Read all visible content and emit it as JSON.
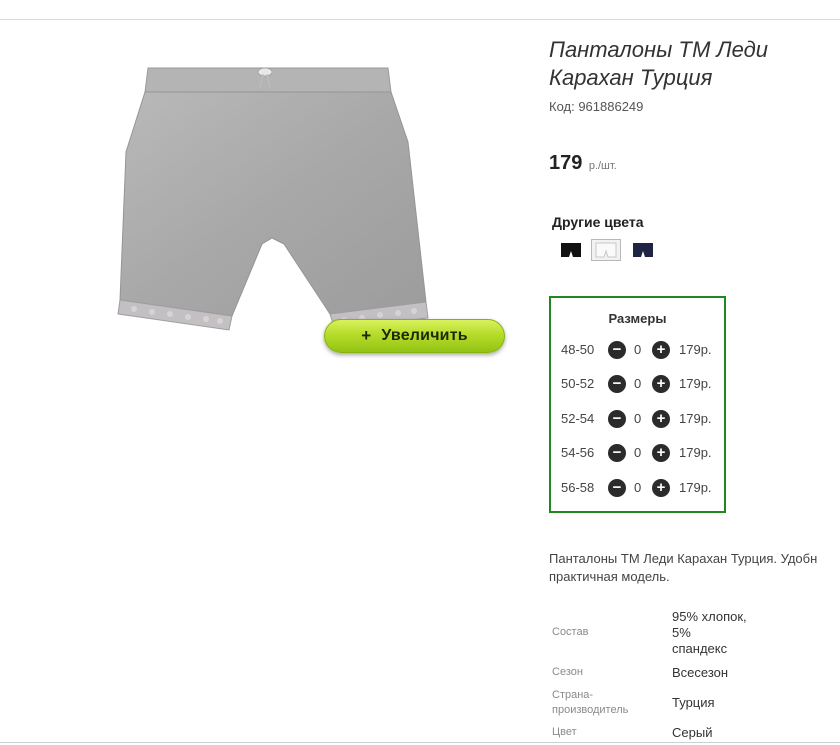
{
  "product": {
    "title": "Панталоны ТМ Леди Карахан Турция",
    "code": "Код: 961886249",
    "price": "179",
    "price_unit": "р./шт.",
    "zoom_label": "Увеличить"
  },
  "colors": {
    "heading": "Другие цвета",
    "swatches": [
      {
        "name": "black",
        "color": "#111111"
      },
      {
        "name": "white",
        "color": "#fafafa"
      },
      {
        "name": "navy",
        "color": "#1f2444"
      }
    ]
  },
  "sizes": {
    "heading": "Размеры",
    "rows": [
      {
        "label": "48-50",
        "qty": "0",
        "price": "179р."
      },
      {
        "label": "50-52",
        "qty": "0",
        "price": "179р."
      },
      {
        "label": "52-54",
        "qty": "0",
        "price": "179р."
      },
      {
        "label": "54-56",
        "qty": "0",
        "price": "179р."
      },
      {
        "label": "56-58",
        "qty": "0",
        "price": "179р."
      }
    ],
    "minus_symbol": "−",
    "plus_symbol": "+"
  },
  "description": {
    "line1": "Панталоны ТМ Леди Карахан Турция. Удобн",
    "line2": "практичная модель."
  },
  "specs": {
    "composition_label": "Состав",
    "composition_value_1": "95% хлопок,",
    "composition_value_2": "5%",
    "composition_value_3": "спандекс",
    "season_label": "Сезон",
    "season_value": "Всесезон",
    "country_label_1": "Страна-",
    "country_label_2": "производитель",
    "country_value": "Турция",
    "color_label": "Цвет",
    "color_value": "Серый"
  },
  "accent_colors": {
    "sizes_border": "#1e8a1e",
    "zoom_button": "#b6dc2a"
  }
}
